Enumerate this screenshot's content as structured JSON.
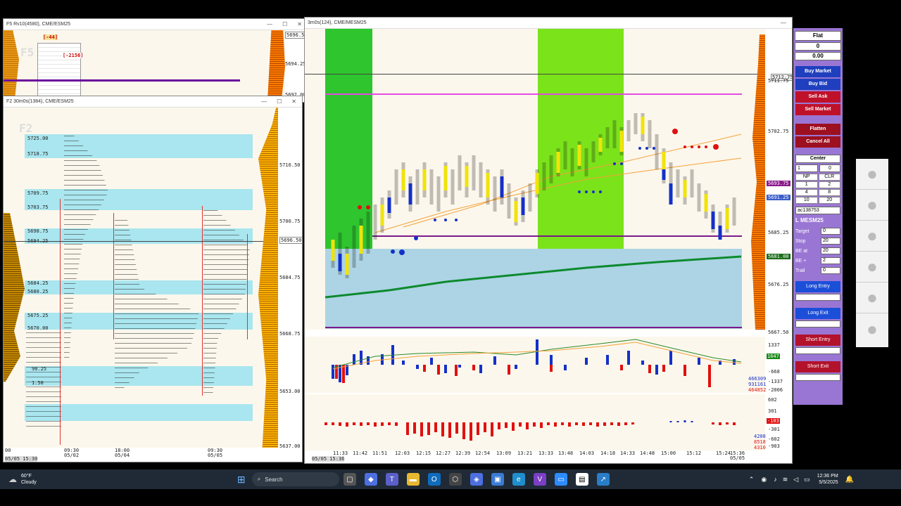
{
  "windows": {
    "f5": {
      "title": "F5 Rv10(4580), CME/ESM25",
      "tag": "F5",
      "delta1": "[-44]",
      "delta2": "[-2156]",
      "prices": [
        "5696.50",
        "5694.25",
        "5692.00"
      ]
    },
    "f2": {
      "title": "F2 30m0s(1384), CME/ESM25",
      "tag": "F2",
      "left_prices": [
        "5725.00",
        "5718.75",
        "5709.75",
        "5703.75",
        "5698.75",
        "5694.25",
        "5684.25",
        "5680.25",
        "5675.25",
        "5670.00",
        "90.25",
        "1.50"
      ],
      "axis_prices": [
        "5716.50",
        "5700.75",
        "5696.50",
        "5684.75",
        "5668.75",
        "5653.00",
        "5637.00"
      ],
      "time_labels": [
        "00",
        "09:30",
        "18:00",
        "09:30"
      ],
      "date_labels": [
        "",
        "05/02",
        "05/04",
        "05/05"
      ],
      "status": "05/05 15:30"
    },
    "main": {
      "title": "3m0s(124), CME/MESM25",
      "axis_prices": [
        "5712.75",
        "5711.75",
        "5702.75",
        "5693.75",
        "5691.25",
        "5685.25",
        "5681.00",
        "5676.25",
        "5667.50"
      ],
      "ind1_values": [
        "1337",
        "1647",
        "-668",
        "-1337",
        "-2006"
      ],
      "ind1_side": [
        "466309",
        "931161",
        "464852"
      ],
      "ind2_values": [
        "602",
        "301",
        "-103",
        "-301",
        "-602",
        "-903"
      ],
      "ind2_side": [
        "4208",
        "8518",
        "4310"
      ],
      "time_labels": [
        "11:33",
        "11:42",
        "11:51",
        "12:03",
        "12:15",
        "12:27",
        "12:39",
        "12:54",
        "13:09",
        "13:21",
        "13:33",
        "13:48",
        "14:03",
        "14:18",
        "14:33",
        "14:48",
        "15:00",
        "15:12",
        "15:24",
        "15:36"
      ],
      "end_date": "05/05",
      "status": "05/05 15:36"
    }
  },
  "order_panel": {
    "position": "Flat",
    "qty": "0",
    "pnl": "0.00",
    "buy_market": "Buy Market",
    "buy_bid": "Buy Bid",
    "sell_ask": "Sell Ask",
    "sell_market": "Sell Market",
    "flatten": "Flatten",
    "cancel_all": "Cancel All",
    "center": "Center",
    "qty_input": "1",
    "qty_right": "0",
    "grid": [
      [
        "NP",
        "CLR"
      ],
      [
        "1",
        "2"
      ],
      [
        "4",
        "8"
      ],
      [
        "10",
        "20"
      ]
    ],
    "account": "ac138753",
    "symbol": "L MESM25",
    "fields": [
      {
        "label": "Target",
        "value": "0"
      },
      {
        "label": "Stop",
        "value": "20"
      },
      {
        "label": "BE at",
        "value": "20"
      },
      {
        "label": "BE +",
        "value": "2"
      },
      {
        "label": "Trail",
        "value": "0"
      }
    ],
    "long_entry": "Long Entry",
    "long_exit": "Long Exit",
    "short_entry": "Short Entry",
    "short_exit": "Short Exit"
  },
  "taskbar": {
    "weather_temp": "60°F",
    "weather_desc": "Cloudy",
    "search": "Search",
    "time": "12:36 PM",
    "date": "5/5/2025"
  },
  "colors": {
    "buy": "#1f3fbf",
    "sell": "#c0112a",
    "flatten": "#9c1020",
    "long": "#1c4fd8",
    "short": "#b3122b",
    "panel_bg": "#9a76d4"
  }
}
